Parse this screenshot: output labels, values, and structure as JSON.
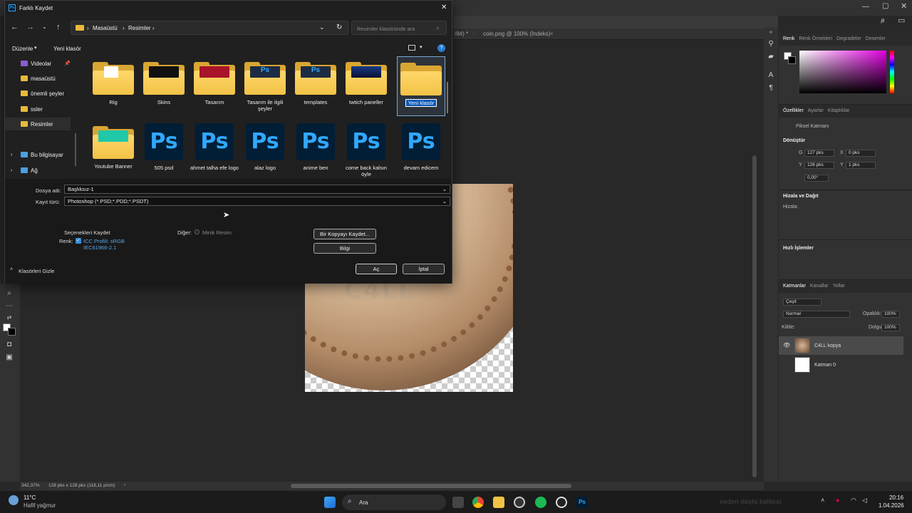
{
  "dialog": {
    "title": "Farklı Kaydet",
    "breadcrumb": [
      "Masaüstü",
      "Resimler"
    ],
    "search_placeholder": "Resimler klasöründe ara",
    "toolbar": {
      "organize": "Düzenle",
      "new_folder": "Yeni klasör"
    },
    "nav": [
      "Videolar",
      "masaüstü",
      "önemli şeyler",
      "ssler",
      "Resimler",
      "Bu bilgisayar",
      "Ağ"
    ],
    "files": [
      {
        "name": "Rig",
        "kind": "folder"
      },
      {
        "name": "Skins",
        "kind": "folder"
      },
      {
        "name": "Tasarım",
        "kind": "folder"
      },
      {
        "name": "Tasarım ile ilgili şeyler",
        "kind": "folder"
      },
      {
        "name": "templates",
        "kind": "folder"
      },
      {
        "name": "twtich paneller",
        "kind": "folder"
      },
      {
        "name": "Yeni klasör",
        "kind": "folder",
        "selected": true
      },
      {
        "name": "Youtube Banner",
        "kind": "folder"
      },
      {
        "name": "505 psd",
        "kind": "psd"
      },
      {
        "name": "ahmet talha efe logo",
        "kind": "psd"
      },
      {
        "name": "alaz logo",
        "kind": "psd"
      },
      {
        "name": "anime ben",
        "kind": "psd"
      },
      {
        "name": "come back kalsın öyle",
        "kind": "psd"
      },
      {
        "name": "devam edicem",
        "kind": "psd"
      }
    ],
    "filename_label": "Dosya adı:",
    "filename_value": "Başlıksız-1",
    "filetype_label": "Kayıt türü:",
    "filetype_value": "Photoshop (*.PSD;*.PDD;*.PSDT)",
    "save_options_label": "Seçenekleri Kaydet",
    "color_label": "Renk:",
    "icc_text": "ICC Profili: sRGB IEC61966-2.1",
    "other_label": "Diğer:",
    "thumbnail_label": "Minik Resim",
    "save_copy_btn": "Bir Kopyayı Kaydet...",
    "info_btn": "Bilgi",
    "hide_folders": "Klasörleri Gizle",
    "open_btn": "Aç",
    "cancel_btn": "İptal"
  },
  "ps": {
    "tab1": "/8#) *",
    "tab2": "coin.png @ 100% (İndeks)",
    "status_zoom": "342,37%",
    "status_size": "128 pks x 128 pks (118,11 p/cm)",
    "color_tabs": [
      "Renk",
      "Renk Örnekleri",
      "Degradeler",
      "Desenler"
    ],
    "prop_tabs": [
      "Özellikler",
      "Ayarlar",
      "Kitaplıklar"
    ],
    "pixel_layer": "Piksel Katmanı",
    "transform": "Dönüştür",
    "g_label": "G",
    "g_val": "127 pks",
    "x_label": "X",
    "x_val": "0 pks",
    "y_label": "Y",
    "y_val": "126 pks",
    "y2_val": "1 pks",
    "angle_val": "0,00°",
    "align": "Hizala ve Dağıt",
    "align_sub": "Hizala:",
    "quick": "Hızlı İşlemler",
    "layer_tabs": [
      "Katmanlar",
      "Kanallar",
      "Yollar"
    ],
    "kind": "Çeşit",
    "blend": "Normal",
    "opacity_label": "Opaklık:",
    "opacity_val": "100%",
    "lock_label": "Kilitle:",
    "fill_label": "Dolgu:",
    "fill_val": "100%",
    "layers": [
      "C4LL kopya",
      "Katman 0"
    ],
    "coin_text": "C4LL"
  },
  "taskbar": {
    "temp": "11°C",
    "weather": "Hafif yağmur",
    "search": "Ara",
    "ticker": "neden düştü kalitesi",
    "time": "20:16",
    "date": "1.04.2026"
  }
}
